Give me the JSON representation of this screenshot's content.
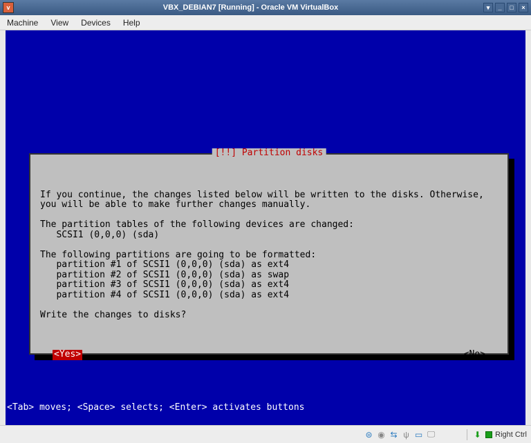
{
  "window": {
    "title": "VBX_DEBIAN7 [Running] - Oracle VM VirtualBox"
  },
  "menubar": {
    "machine": "Machine",
    "view": "View",
    "devices": "Devices",
    "help": "Help"
  },
  "dialog": {
    "title": "[!!] Partition disks",
    "intro": "If you continue, the changes listed below will be written to the disks. Otherwise, you will be able to make further changes manually.",
    "tables_header": "The partition tables of the following devices are changed:",
    "tables_item": "   SCSI1 (0,0,0) (sda)",
    "format_header": "The following partitions are going to be formatted:",
    "format_items": [
      "   partition #1 of SCSI1 (0,0,0) (sda) as ext4",
      "   partition #2 of SCSI1 (0,0,0) (sda) as swap",
      "   partition #3 of SCSI1 (0,0,0) (sda) as ext4",
      "   partition #4 of SCSI1 (0,0,0) (sda) as ext4"
    ],
    "question": "Write the changes to disks?",
    "yes": "<Yes>",
    "no": "<No>"
  },
  "hint": "<Tab> moves; <Space> selects; <Enter> activates buttons",
  "statusbar": {
    "host_key": "Right Ctrl"
  }
}
